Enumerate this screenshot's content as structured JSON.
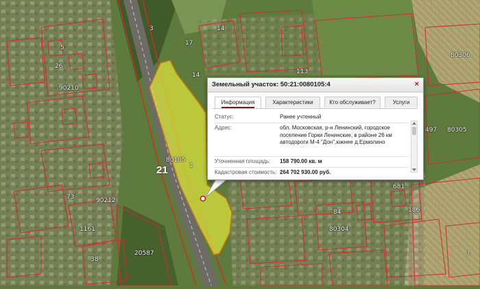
{
  "map": {
    "road_label": "21",
    "parcel_labels": [
      "3",
      "14",
      "17",
      "113",
      "80306",
      "497",
      "80305",
      "26",
      "90210",
      "80105",
      "1",
      "14",
      "5",
      "90212",
      "73",
      "1161",
      "20587",
      "38",
      "84",
      "80304",
      "681",
      "186",
      "7"
    ]
  },
  "popup": {
    "title": "Земельный участок: 50:21:0080105:4",
    "close_label": "×",
    "tabs": [
      "Информация",
      "Характеристики",
      "Кто обслуживает?",
      "Услуги"
    ],
    "active_tab": "Информация",
    "rows": [
      {
        "label": "Статус:",
        "value": "Ранее учтенный"
      },
      {
        "label": "Адрес:",
        "value": "обл. Московская, р-н Ленинский, городское поселение Горки Ленинские, в районе 26 км автодороги М-4 \"Дон\",южнее д.Ермолино"
      },
      {
        "label": "Уточненная площадь:",
        "value": "158 790.00 кв. м"
      },
      {
        "label": "Кадастровая стоимость:",
        "value": "264 702 930.00 руб."
      }
    ]
  },
  "colors": {
    "parcel_outline": "#d42a2a",
    "selected_parcel_fill": "#e2ea3c",
    "popup_close": "#b01818",
    "active_tab_underline": "#7a1717"
  },
  "icons": [
    "close-icon",
    "map-marker-icon",
    "scroll-up-arrow-icon",
    "scroll-down-arrow-icon"
  ]
}
